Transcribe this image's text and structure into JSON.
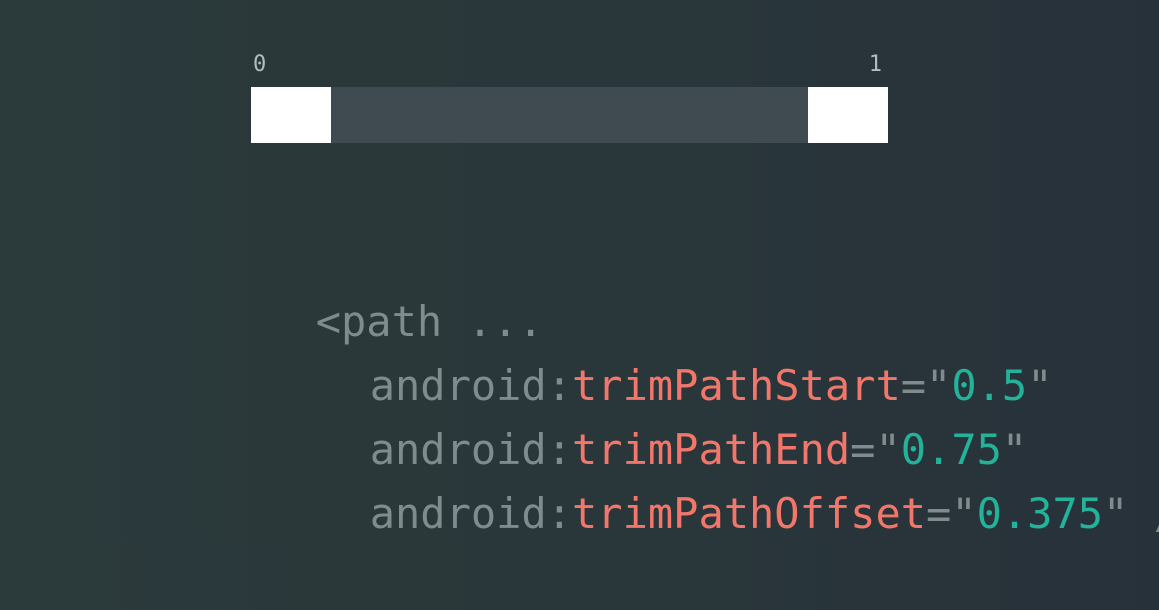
{
  "range": {
    "start_label": "0",
    "end_label": "1",
    "visible_segments": [
      {
        "from": 0.0,
        "to": 0.125
      },
      {
        "from": 0.875,
        "to": 1.0
      }
    ],
    "colors": {
      "track": "#3f4b50",
      "segment": "#ffffff"
    }
  },
  "code": {
    "lines": [
      [
        {
          "text": "<path ...",
          "kind": "plain"
        }
      ],
      [
        {
          "text": "android:",
          "kind": "plain"
        },
        {
          "text": "trimPathStart",
          "kind": "attr"
        },
        {
          "text": "=\"",
          "kind": "plain"
        },
        {
          "text": "0.5",
          "kind": "value"
        },
        {
          "text": "\"",
          "kind": "plain"
        }
      ],
      [
        {
          "text": "android:",
          "kind": "plain"
        },
        {
          "text": "trimPathEnd",
          "kind": "attr"
        },
        {
          "text": "=\"",
          "kind": "plain"
        },
        {
          "text": "0.75",
          "kind": "value"
        },
        {
          "text": "\"",
          "kind": "plain"
        }
      ],
      [
        {
          "text": "android:",
          "kind": "plain"
        },
        {
          "text": "trimPathOffset",
          "kind": "attr"
        },
        {
          "text": "=\"",
          "kind": "plain"
        },
        {
          "text": "0.375",
          "kind": "value"
        },
        {
          "text": "\" />",
          "kind": "plain"
        }
      ]
    ],
    "colors": {
      "plain": "#7f8b8c",
      "attr": "#f2766a",
      "value": "#22b39a"
    }
  }
}
